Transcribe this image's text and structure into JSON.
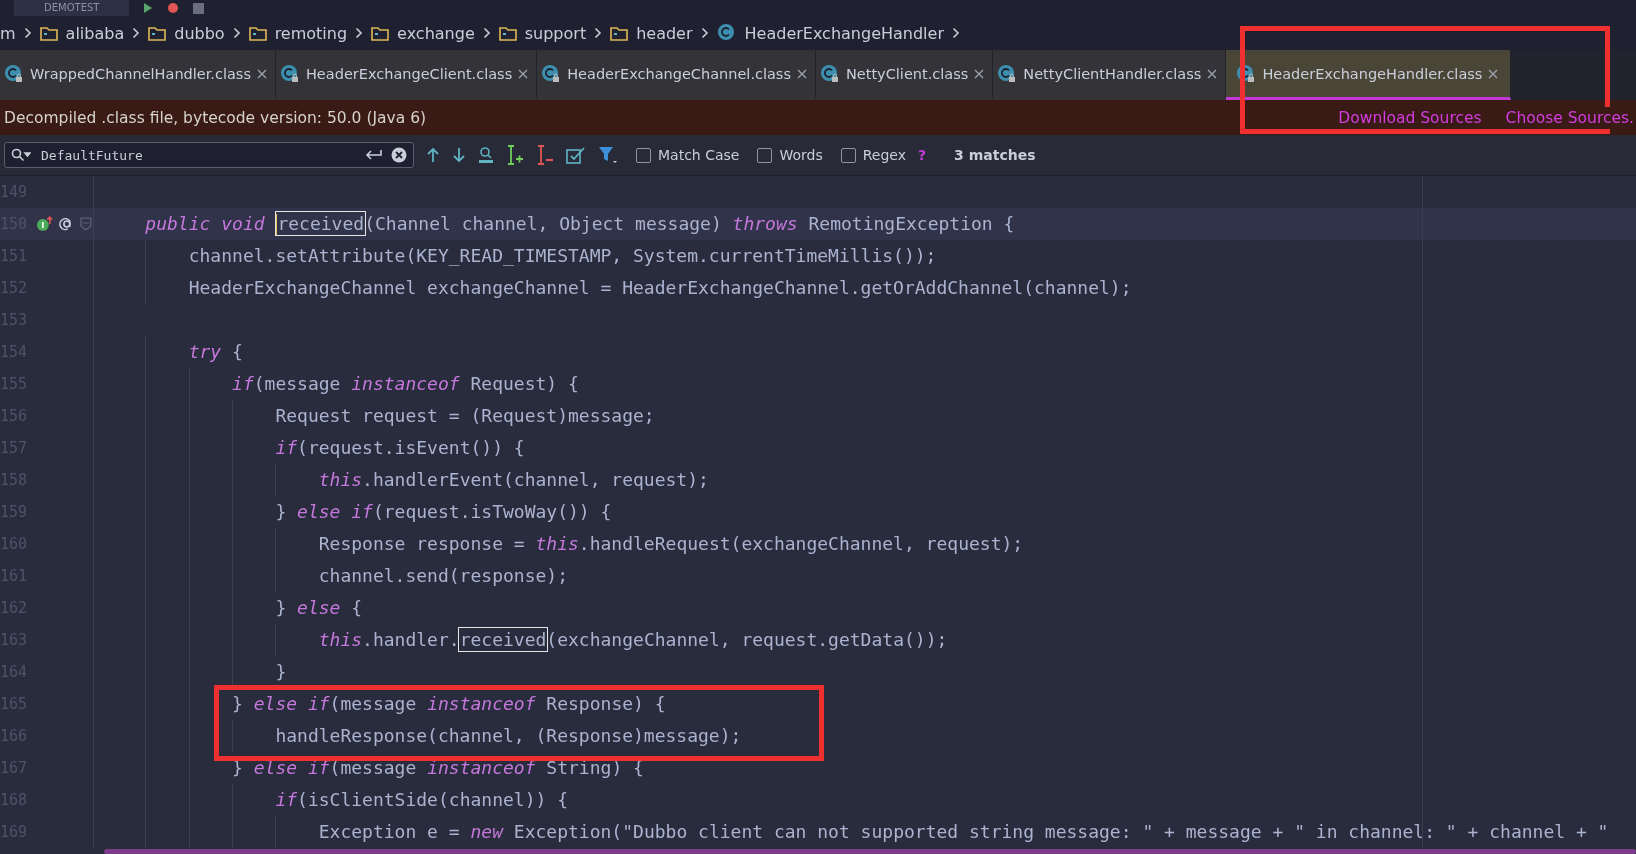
{
  "toolbar": {
    "run_config": "DEMOTEST"
  },
  "breadcrumbs": [
    {
      "label": "m",
      "kind": "text"
    },
    {
      "label": "alibaba",
      "kind": "folder"
    },
    {
      "label": "dubbo",
      "kind": "folder"
    },
    {
      "label": "remoting",
      "kind": "folder"
    },
    {
      "label": "exchange",
      "kind": "folder"
    },
    {
      "label": "support",
      "kind": "folder"
    },
    {
      "label": "header",
      "kind": "folder"
    },
    {
      "label": "HeaderExchangeHandler",
      "kind": "class"
    }
  ],
  "tabs": [
    {
      "label": "WrappedChannelHandler.class",
      "selected": false
    },
    {
      "label": "HeaderExchangeClient.class",
      "selected": false
    },
    {
      "label": "HeaderExchangeChannel.class",
      "selected": false
    },
    {
      "label": "NettyClient.class",
      "selected": false
    },
    {
      "label": "NettyClientHandler.class",
      "selected": false
    },
    {
      "label": "HeaderExchangeHandler.class",
      "selected": true
    }
  ],
  "banner": {
    "message": "Decompiled .class file, bytecode version: 50.0 (Java 6)",
    "links": [
      "Download Sources",
      "Choose Sources."
    ]
  },
  "search": {
    "value": "DefaultFuture",
    "options": [
      {
        "label": "Match Case",
        "checked": false
      },
      {
        "label": "Words",
        "checked": false
      },
      {
        "label": "Regex",
        "checked": false
      }
    ],
    "help": "?",
    "matches": "3 matches"
  },
  "code": [
    {
      "number": "149",
      "current": false
    },
    {
      "number": "150",
      "current": true,
      "tokens": [
        {
          "kind": "kw",
          "text": "    public"
        },
        {
          "kind": "kw",
          "text": "void"
        },
        {
          "kind": "match",
          "text": "received"
        },
        {
          "kind": "id",
          "text": "(Channel channel, Object message)"
        },
        {
          "kind": "kw",
          "text": "throws"
        },
        {
          "kind": "id",
          "text": "RemotingException {"
        }
      ]
    },
    {
      "number": "151",
      "current": false,
      "tokens": [
        {
          "kind": "id",
          "text": "        channel.setAttribute(KEY_READ_TIMESTAMP, System.currentTimeMillis());"
        }
      ]
    },
    {
      "number": "152",
      "current": false,
      "tokens": [
        {
          "kind": "id",
          "text": "        HeaderExchangeChannel exchangeChannel = HeaderExchangeChannel.getOrAddChannel(channel);"
        }
      ]
    },
    {
      "number": "153",
      "current": false
    },
    {
      "number": "154",
      "current": false,
      "tokens": [
        {
          "kind": "kw",
          "text": "        try"
        },
        {
          "kind": "id",
          "text": "{"
        }
      ]
    },
    {
      "number": "155",
      "current": false,
      "tokens": [
        {
          "kind": "kw",
          "text": "            if"
        },
        {
          "kind": "id",
          "text": "(message"
        },
        {
          "kind": "kw",
          "text": "instanceof"
        },
        {
          "kind": "id",
          "text": "Request) {"
        }
      ]
    },
    {
      "number": "156",
      "current": false,
      "tokens": [
        {
          "kind": "id",
          "text": "                Request request = (Request)message;"
        }
      ]
    },
    {
      "number": "157",
      "current": false,
      "tokens": [
        {
          "kind": "kw",
          "text": "                if"
        },
        {
          "kind": "id",
          "text": "(request.isEvent()) {"
        }
      ]
    },
    {
      "number": "158",
      "current": false,
      "tokens": [
        {
          "kind": "kw",
          "text": "                    this"
        },
        {
          "kind": "id",
          "text": ".handlerEvent(channel, request);"
        }
      ]
    },
    {
      "number": "159",
      "current": false,
      "tokens": [
        {
          "kind": "id",
          "text": "                }"
        },
        {
          "kind": "kw",
          "text": "else if"
        },
        {
          "kind": "id",
          "text": "(request.isTwoWay()) {"
        }
      ]
    },
    {
      "number": "160",
      "current": false,
      "tokens": [
        {
          "kind": "id",
          "text": "                    Response response ="
        },
        {
          "kind": "kw",
          "text": "this"
        },
        {
          "kind": "id",
          "text": ".handleRequest(exchangeChannel, request);"
        }
      ]
    },
    {
      "number": "161",
      "current": false,
      "tokens": [
        {
          "kind": "id",
          "text": "                    channel.send(response);"
        }
      ]
    },
    {
      "number": "162",
      "current": false,
      "tokens": [
        {
          "kind": "id",
          "text": "                }"
        },
        {
          "kind": "kw",
          "text": "else"
        },
        {
          "kind": "id",
          "text": "{"
        }
      ]
    },
    {
      "number": "163",
      "current": false,
      "tokens": [
        {
          "kind": "kw",
          "text": "                    this"
        },
        {
          "kind": "id",
          "text": ".handler."
        },
        {
          "kind": "match",
          "text": "received"
        },
        {
          "kind": "id",
          "text": "(exchangeChannel, request.getData());"
        }
      ]
    },
    {
      "number": "164",
      "current": false,
      "tokens": [
        {
          "kind": "id",
          "text": "                }"
        }
      ]
    },
    {
      "number": "165",
      "current": false,
      "tokens": [
        {
          "kind": "id",
          "text": "            }"
        },
        {
          "kind": "kw",
          "text": "else if"
        },
        {
          "kind": "id",
          "text": "(message"
        },
        {
          "kind": "kw",
          "text": "instanceof"
        },
        {
          "kind": "id",
          "text": "Response) {"
        }
      ]
    },
    {
      "number": "166",
      "current": false,
      "tokens": [
        {
          "kind": "id",
          "text": "                handleResponse(channel, (Response)message);"
        }
      ]
    },
    {
      "number": "167",
      "current": false,
      "tokens": [
        {
          "kind": "id",
          "text": "            }"
        },
        {
          "kind": "kw",
          "text": "else if"
        },
        {
          "kind": "id",
          "text": "(message"
        },
        {
          "kind": "kw",
          "text": "instanceof"
        },
        {
          "kind": "id",
          "text": "String) {"
        }
      ]
    },
    {
      "number": "168",
      "current": false,
      "tokens": [
        {
          "kind": "kw",
          "text": "                if"
        },
        {
          "kind": "id",
          "text": "(isClientSide(channel)) {"
        }
      ]
    },
    {
      "number": "169",
      "current": false,
      "tokens": [
        {
          "kind": "id",
          "text": "                    Exception e ="
        },
        {
          "kind": "kw",
          "text": "new"
        },
        {
          "kind": "id",
          "text": "Exception("
        },
        {
          "kind": "str",
          "text": "\"Dubbo client can not supported string message: \""
        },
        {
          "kind": "id",
          "text": "+ message +"
        },
        {
          "kind": "str",
          "text": "\" in channel: \""
        },
        {
          "kind": "id",
          "text": "+ channel +"
        },
        {
          "kind": "str",
          "text": "\""
        }
      ]
    }
  ]
}
